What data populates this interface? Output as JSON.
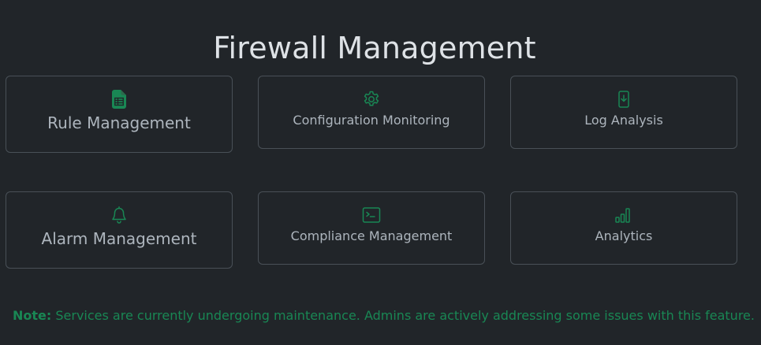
{
  "page": {
    "title": "Firewall Management"
  },
  "cards": [
    {
      "label": "Rule Management",
      "icon": "file-spreadsheet-icon"
    },
    {
      "label": "Configuration Monitoring",
      "icon": "gear-icon"
    },
    {
      "label": "Log Analysis",
      "icon": "phone-download-icon"
    },
    {
      "label": "Alarm Management",
      "icon": "bell-icon"
    },
    {
      "label": "Compliance Management",
      "icon": "terminal-icon"
    },
    {
      "label": "Analytics",
      "icon": "bar-chart-icon"
    }
  ],
  "note": {
    "prefix": "Note:",
    "text": "Services are currently undergoing maintenance. Admins are actively addressing some issues with this feature."
  },
  "colors": {
    "background": "#212529",
    "accent": "#198754",
    "border": "#495057",
    "text": "#adb5bd",
    "title": "#dee2e6"
  }
}
